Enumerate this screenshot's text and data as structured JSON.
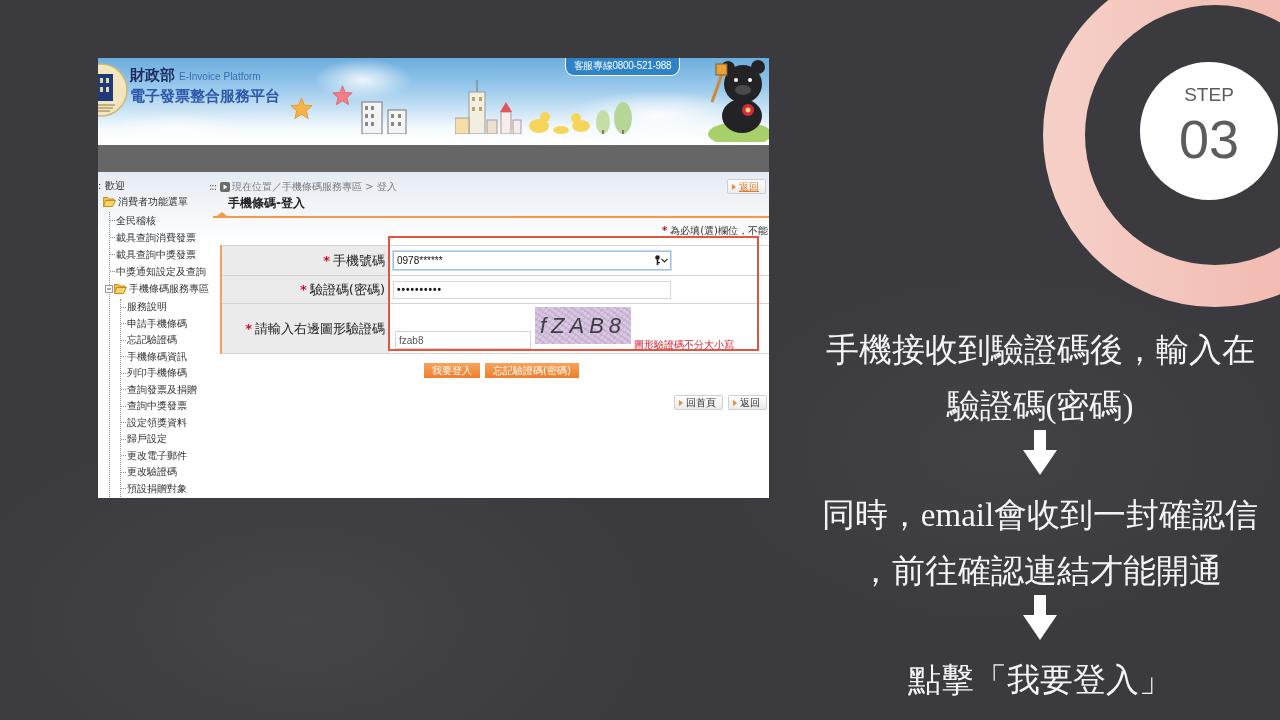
{
  "screenshot": {
    "header": {
      "agency": "財政部",
      "platform_en": "E-Invoice Platform",
      "platform_zh": "電子發票整合服務平台",
      "hotline": "客服專線0800-521-988"
    },
    "sidebar": {
      "welcome": ": 歡迎",
      "tree": [
        {
          "kind": "folder",
          "label": "消費者功能選單",
          "expanded": true,
          "children": [
            {
              "kind": "page",
              "label": "全民稽核"
            },
            {
              "kind": "page",
              "label": "載具查詢消費發票"
            },
            {
              "kind": "page",
              "label": "載具查詢中獎發票"
            },
            {
              "kind": "page",
              "label": "中獎通知設定及查詢"
            },
            {
              "kind": "folder",
              "label": "手機條碼服務專區",
              "expanded": true,
              "children": [
                {
                  "kind": "page",
                  "label": "服務說明"
                },
                {
                  "kind": "page",
                  "label": "申請手機條碼"
                },
                {
                  "kind": "page",
                  "label": "忘記驗證碼"
                },
                {
                  "kind": "page",
                  "label": "手機條碼資訊"
                },
                {
                  "kind": "page",
                  "label": "列印手機條碼"
                },
                {
                  "kind": "page",
                  "label": "查詢發票及捐贈"
                },
                {
                  "kind": "page",
                  "label": "查詢中獎發票"
                },
                {
                  "kind": "page",
                  "label": "設定領獎資料"
                },
                {
                  "kind": "page",
                  "label": "歸戶設定"
                },
                {
                  "kind": "page",
                  "label": "更改電子郵件"
                },
                {
                  "kind": "page",
                  "label": "更改驗證碼"
                },
                {
                  "kind": "page",
                  "label": "預設捐贈對象"
                }
              ]
            }
          ]
        }
      ]
    },
    "breadcrumb": {
      "marker": ":::",
      "text": "現在位置／手機條碼服務專區 > 登入"
    },
    "back_link": "返回",
    "title": "手機條碼-登入",
    "required_note": {
      "mark": "*",
      "text": "為必填(選)欄位，不能"
    },
    "fields": [
      {
        "kind": "text",
        "mark": "*",
        "label": "手機號碼",
        "value": "0978******",
        "focused": true,
        "autofill": true
      },
      {
        "kind": "password",
        "mark": "*",
        "label": "驗證碼(密碼)",
        "value": "••••••••••",
        "focused": false,
        "autofill": false
      },
      {
        "kind": "captcha",
        "mark": "*",
        "label": "請輸入右邊圖形驗證碼",
        "value": "fzab8",
        "focused": false,
        "autofill": false,
        "captcha": "fZAB8",
        "hint": "圖形驗證碼不分大小寫"
      }
    ],
    "buttons": [
      "我要登入",
      "忘記驗證碼(密碼)"
    ],
    "footer_links": [
      "回首頁",
      "返回"
    ]
  },
  "step_badge": {
    "label": "STEP",
    "number": "03"
  },
  "steps": [
    {
      "lines": [
        "手機接收到驗證碼後，輸入在",
        "驗證碼(密碼)"
      ]
    },
    {
      "lines": [
        "同時，email會收到一封確認信",
        "，前往確認連結才能開通"
      ]
    },
    {
      "lines": [
        "點擊「我要登入」"
      ]
    }
  ]
}
